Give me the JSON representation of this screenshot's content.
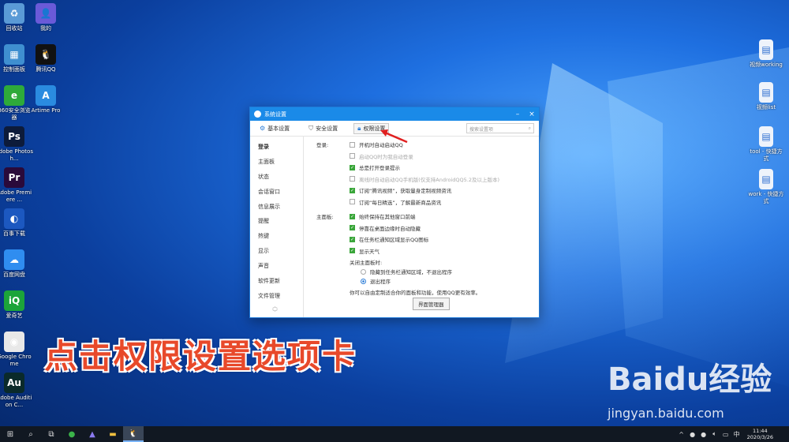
{
  "desktop_left": [
    {
      "label": "回收站",
      "icon": "recycle-bin-icon",
      "color": "#5a9ad6",
      "glyph": "♻"
    },
    {
      "label": "我的",
      "icon": "user-icon",
      "color": "#6a5ad8",
      "glyph": "👤"
    },
    {
      "label": "控制面板",
      "icon": "control-panel-icon",
      "color": "#3f8fd0",
      "glyph": "▦"
    },
    {
      "label": "腾讯QQ",
      "icon": "qq-icon",
      "color": "#111111",
      "glyph": "🐧"
    },
    {
      "label": "360安全浏览器",
      "icon": "browser-360-icon",
      "color": "#2eaa3a",
      "glyph": "e"
    },
    {
      "label": "Artime Pro",
      "icon": "artime-icon",
      "color": "#2a8be0",
      "glyph": "A"
    },
    {
      "label": "Adobe Photosh...",
      "icon": "photoshop-icon",
      "color": "#0d1b3a",
      "glyph": "Ps"
    },
    {
      "label": "Adobe Premiere ...",
      "icon": "premiere-icon",
      "color": "#2a0a3a",
      "glyph": "Pr"
    },
    {
      "label": "百事下载",
      "icon": "pepsi-icon",
      "color": "#1c58c0",
      "glyph": "◐"
    },
    {
      "label": "百度网盘",
      "icon": "baidu-pan-icon",
      "color": "#2f8df0",
      "glyph": "☁"
    },
    {
      "label": "爱奇艺",
      "icon": "iqiyi-icon",
      "color": "#1ca43a",
      "glyph": "iQ"
    },
    {
      "label": "Google Chrome",
      "icon": "chrome-icon",
      "color": "#e8e8e8",
      "glyph": "◉"
    },
    {
      "label": "Adobe Audition C...",
      "icon": "audition-icon",
      "color": "#0a2a2a",
      "glyph": "Au"
    }
  ],
  "desktop_right": [
    {
      "label": "视频working",
      "icon": "file-icon"
    },
    {
      "label": "视频list",
      "icon": "file-icon"
    },
    {
      "label": "tool - 快捷方式",
      "icon": "shortcut-icon"
    },
    {
      "label": "work - 快捷方式",
      "icon": "shortcut-icon"
    }
  ],
  "window": {
    "title": "系统设置",
    "tabs": [
      {
        "label": "基本设置",
        "icon": "gear-icon"
      },
      {
        "label": "安全设置",
        "icon": "shield-icon"
      },
      {
        "label": "权限设置",
        "icon": "lock-icon"
      }
    ],
    "search_placeholder": "搜索设置项",
    "sidebar": [
      "登录",
      "主面板",
      "状态",
      "会话窗口",
      "信息展示",
      "提醒",
      "热键",
      "显示",
      "声音",
      "软件更新",
      "文件管理"
    ],
    "login_label": "登录:",
    "login_options": [
      {
        "label": "开机时自动启动QQ",
        "checked": false,
        "disabled": false
      },
      {
        "label": "启动QQ时为我自动登录",
        "checked": false,
        "disabled": true
      },
      {
        "label": "总是打开登录提示",
        "checked": true,
        "disabled": false
      },
      {
        "label": "离线时自动启动QQ手机版(仅支持AndroidQQ5.2及以上版本)",
        "checked": false,
        "disabled": true
      },
      {
        "label": "订阅“腾讯视频”，获取量身定制视频资讯",
        "checked": true,
        "disabled": false
      },
      {
        "label": "订阅“每日精选”，了解最新商品资讯",
        "checked": false,
        "disabled": false
      }
    ],
    "panel_label": "主面板:",
    "panel_options": [
      {
        "label": "始终保持在其他窗口前端",
        "checked": true
      },
      {
        "label": "停靠在桌面边缘时自动隐藏",
        "checked": true
      },
      {
        "label": "在任务栏通知区域显示QQ图标",
        "checked": true
      },
      {
        "label": "显示天气",
        "checked": true
      }
    ],
    "close_label": "关闭主面板时:",
    "close_options": [
      {
        "label": "隐藏到任务栏通知区域，不退出程序",
        "selected": false
      },
      {
        "label": "退出程序",
        "selected": true
      }
    ],
    "custom_note": "你可以自由定制适合你的面板和功能，使用QQ更有效率。",
    "manager_button": "界面管理器"
  },
  "caption": "点击权限设置选项卡",
  "watermark": {
    "brand": "Baidu经验",
    "url": "jingyan.baidu.com"
  },
  "taskbar": {
    "time": "11:44",
    "date": "2020/3/26"
  }
}
